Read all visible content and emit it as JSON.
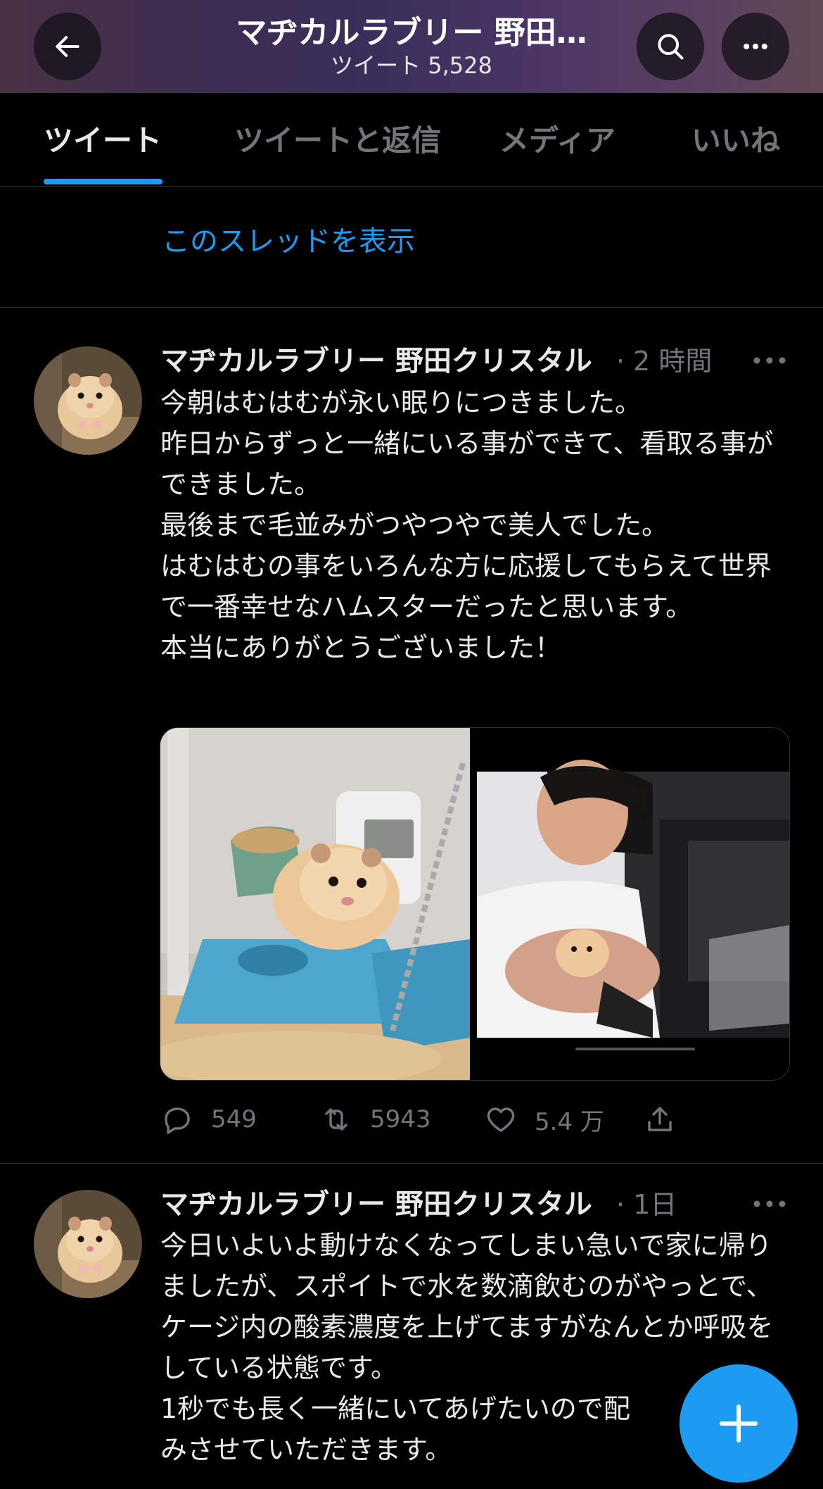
{
  "header": {
    "title": "マヂカルラブリー 野田…",
    "subtitle": "ツイート 5,528",
    "back_icon": "arrow-left-icon",
    "search_icon": "search-icon",
    "more_icon": "more-horizontal-icon"
  },
  "tabs": [
    {
      "label": "ツイート",
      "active": true
    },
    {
      "label": "ツイートと返信",
      "active": false
    },
    {
      "label": "メディア",
      "active": false
    },
    {
      "label": "いいね",
      "active": false
    }
  ],
  "thread_link": "このスレッドを表示",
  "tweets": [
    {
      "author": "マヂカルラブリー 野田クリスタル",
      "time": "· 2 時間",
      "body": "今朝はむはむが永い眠りにつきました。\n昨日からずっと一緒にいる事ができて、看取る事ができました。\n最後まで毛並みがつやつやで美人でした。\nはむはむの事をいろんな方に応援してもらえて世界で一番幸せなハムスターだったと思います。\n本当にありがとうございました！",
      "media": [
        "hamster-in-cage-photo",
        "man-holding-hamster-photo"
      ],
      "stats": {
        "replies": "549",
        "retweets": "5943",
        "likes": "5.4 万"
      }
    },
    {
      "author": "マヂカルラブリー 野田クリスタル",
      "time": "· 1日",
      "body": "今日いよいよ動けなくなってしまい急いで家に帰りましたが、スポイトで水を数滴飲むのがやっとで、ケージ内の酸素濃度を上げてますがなんとか呼吸をしている状態です。\n1秒でも長く一緒にいてあげたいので配\nみさせていただきます。"
    }
  ],
  "fab_icon": "compose-plus-icon",
  "colors": {
    "accent": "#1d9bf0",
    "muted": "#71767b",
    "text": "#e7e9ea",
    "background": "#000000"
  }
}
